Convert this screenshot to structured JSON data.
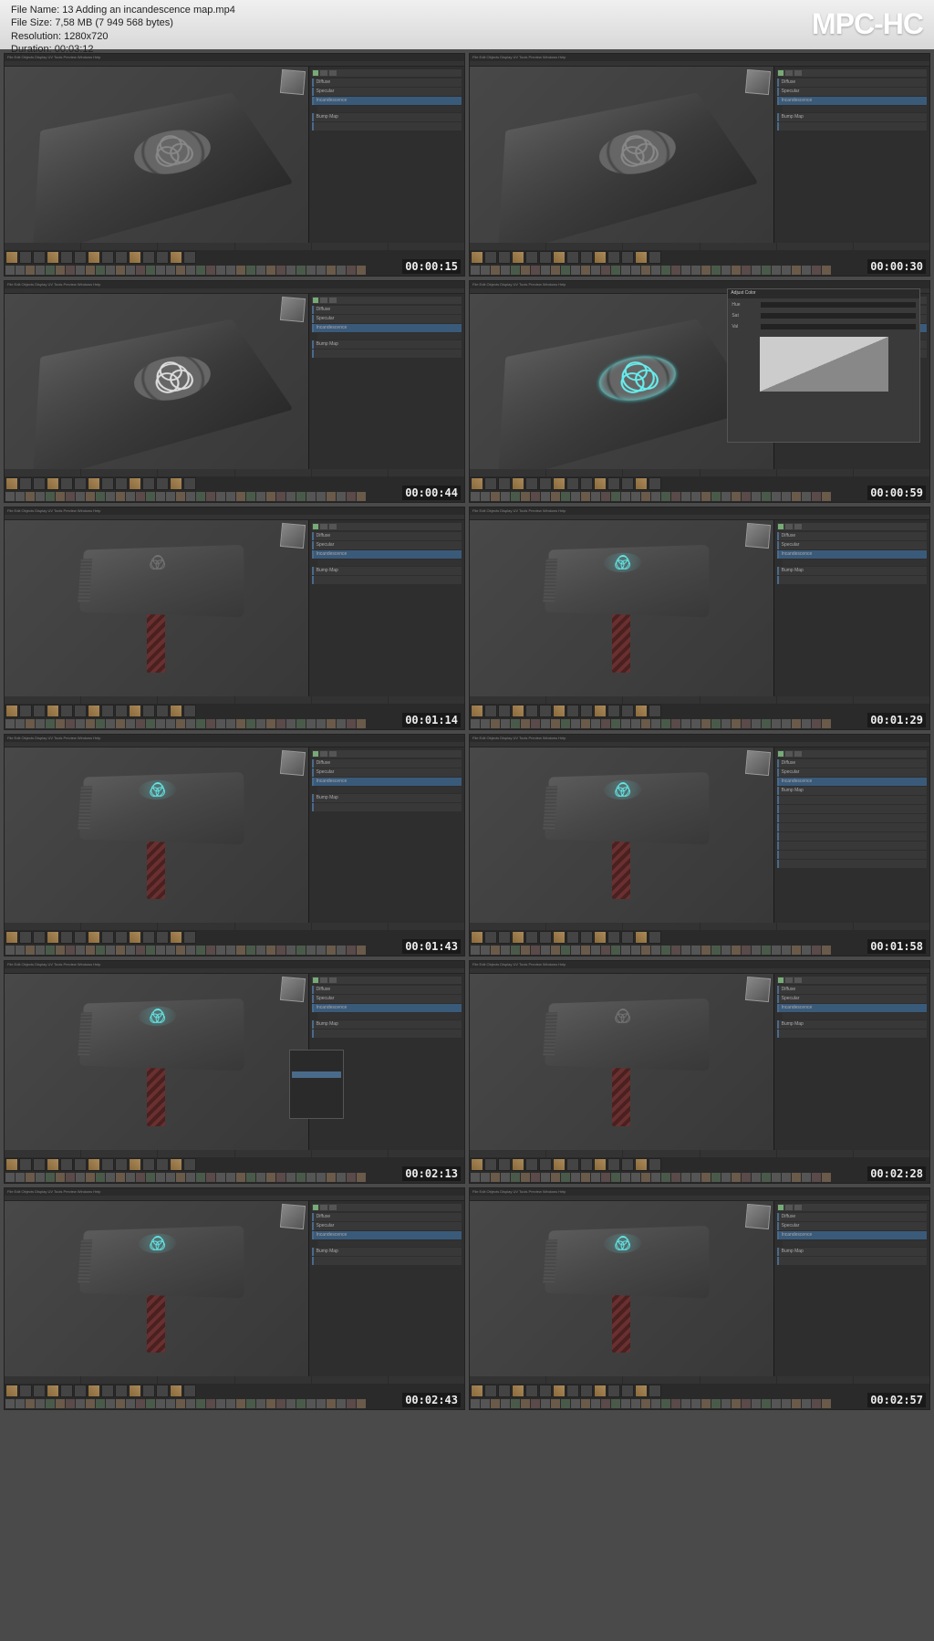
{
  "header": {
    "filename_label": "File Name:",
    "filename": "13 Adding an incandescence map.mp4",
    "filesize_label": "File Size:",
    "filesize": "7,58 MB (7 949 568 bytes)",
    "resolution_label": "Resolution:",
    "resolution": "1280x720",
    "duration_label": "Duration:",
    "duration": "00:03:12",
    "app_logo": "MPC-HC"
  },
  "thumbnails": [
    {
      "timestamp": "00:00:15",
      "view": "top",
      "glow": false
    },
    {
      "timestamp": "00:00:30",
      "view": "top",
      "glow": false
    },
    {
      "timestamp": "00:00:44",
      "view": "top",
      "glow": false,
      "white_emblem": true
    },
    {
      "timestamp": "00:00:59",
      "view": "top",
      "glow": true,
      "dialog": true
    },
    {
      "timestamp": "00:01:14",
      "view": "full",
      "glow": false
    },
    {
      "timestamp": "00:01:29",
      "view": "full",
      "glow": true
    },
    {
      "timestamp": "00:01:43",
      "view": "full",
      "glow": true
    },
    {
      "timestamp": "00:01:58",
      "view": "full",
      "glow": true,
      "long_panel": true
    },
    {
      "timestamp": "00:02:13",
      "view": "full",
      "glow": true,
      "context_menu": true
    },
    {
      "timestamp": "00:02:28",
      "view": "full",
      "glow": false
    },
    {
      "timestamp": "00:02:43",
      "view": "full",
      "glow": true
    },
    {
      "timestamp": "00:02:57",
      "view": "full",
      "glow": true
    }
  ],
  "panel": {
    "sections": [
      "Diffuse",
      "Specular",
      "Incandescence",
      "Bump Map"
    ],
    "dialog_title": "Adjust Color",
    "dialog_fields": [
      "Hue",
      "Sat",
      "Val"
    ]
  }
}
